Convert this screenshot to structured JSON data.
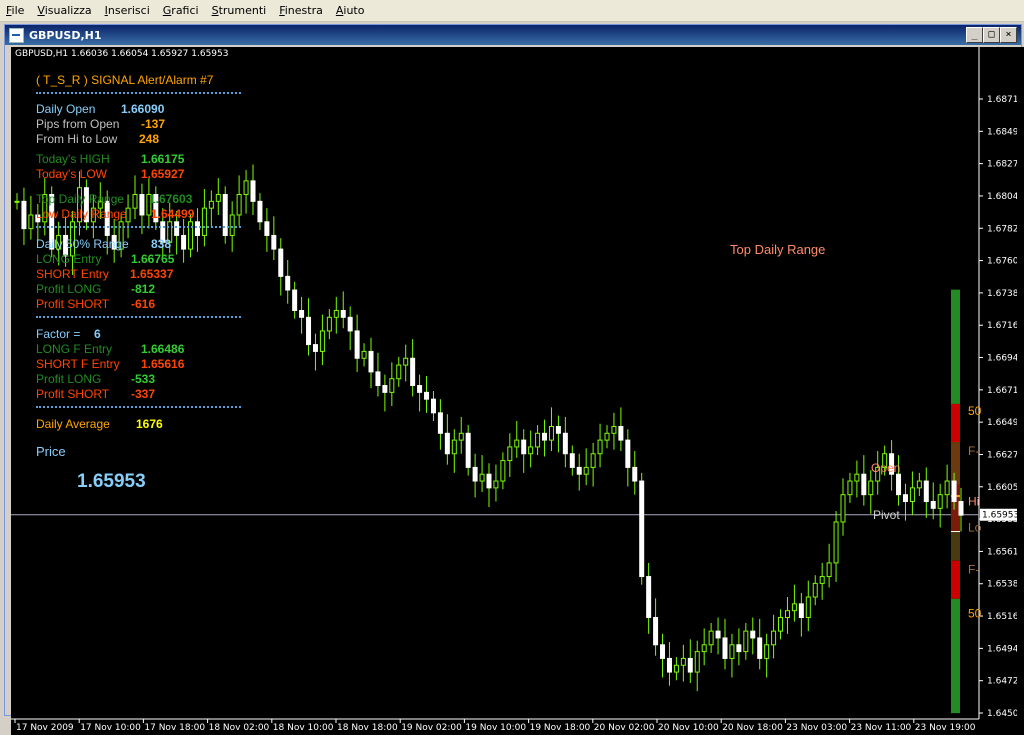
{
  "menu": [
    "File",
    "Visualizza",
    "Inserisci",
    "Grafici",
    "Strumenti",
    "Finestra",
    "Aiuto"
  ],
  "window": {
    "title": "GBPUSD,H1",
    "buttons": [
      "_",
      "□",
      "×"
    ]
  },
  "chart_header": "GBPUSD,H1  1.66036 1.66054 1.65927 1.65953",
  "indicator": {
    "title": "( T_S_R ) SIGNAL Alert/Alarm #7",
    "rows": [
      {
        "label": "Daily Open",
        "value": "1.66090",
        "label_color": "#87cefa",
        "value_color": "#87cefa"
      },
      {
        "label": "Pips from Open",
        "value": "-137",
        "label_color": "#c0c0c0",
        "value_color": "#ffa500"
      },
      {
        "label": "From Hi to Low",
        "value": "248",
        "label_color": "#c0c0c0",
        "value_color": "#ffa500"
      },
      {
        "label": "Today's HIGH",
        "value": "1.66175",
        "label_color": "#228b22",
        "value_color": "#32cd32"
      },
      {
        "label": "Today's LOW",
        "value": "1.65927",
        "label_color": "#ff4500",
        "value_color": "#ff4500"
      },
      {
        "label": "Top Daily Range",
        "value": "1.67603",
        "label_color": "#228b22",
        "value_color": "#228b22"
      },
      {
        "label": "Low Daily Range",
        "value": "1.64499",
        "label_color": "#ff4500",
        "value_color": "#ff4500"
      },
      {
        "label": "Daily 50% Range",
        "value": "838",
        "label_color": "#87cefa",
        "value_color": "#87cefa"
      },
      {
        "label": "LONG Entry",
        "value": "1.66765",
        "label_color": "#228b22",
        "value_color": "#32cd32"
      },
      {
        "label": "SHORT Entry",
        "value": "1.65337",
        "label_color": "#ff4500",
        "value_color": "#ff4500"
      },
      {
        "label": "Profit LONG",
        "value": "-812",
        "label_color": "#228b22",
        "value_color": "#32cd32"
      },
      {
        "label": "Profit SHORT",
        "value": "-616",
        "label_color": "#ff4500",
        "value_color": "#ff4500"
      },
      {
        "label": "Factor =",
        "value": "6",
        "label_color": "#87cefa",
        "value_color": "#87cefa"
      },
      {
        "label": "LONG F Entry",
        "value": "1.66486",
        "label_color": "#228b22",
        "value_color": "#32cd32"
      },
      {
        "label": "SHORT F Entry",
        "value": "1.65616",
        "label_color": "#ff4500",
        "value_color": "#ff4500"
      },
      {
        "label": "Profit LONG",
        "value": "-533",
        "label_color": "#228b22",
        "value_color": "#32cd32"
      },
      {
        "label": "Profit SHORT",
        "value": "-337",
        "label_color": "#ff4500",
        "value_color": "#ff4500"
      },
      {
        "label": "Daily Average",
        "value": "1676",
        "label_color": "#ffa500",
        "value_color": "#ffff00"
      }
    ],
    "price_label": "Price",
    "price_value": "1.65953"
  },
  "chart_labels": {
    "top_daily_range": "Top Daily Range",
    "open": "Open",
    "pivot": "Pivot",
    "right_labels": [
      "50",
      "F-",
      "Hi",
      "Lo",
      "F-",
      "50"
    ]
  },
  "chart_data": {
    "type": "candlestick",
    "symbol": "GBPUSD",
    "timeframe": "H1",
    "current_price": 1.65953,
    "ylim": [
      1.645,
      1.69
    ],
    "y_ticks": [
      "1.68710",
      "1.68490",
      "1.68270",
      "1.68045",
      "1.67825",
      "1.67605",
      "1.67380",
      "1.67160",
      "1.66940",
      "1.66715",
      "1.66495",
      "1.66275",
      "1.66050",
      "1.65830",
      "1.65610",
      "1.65385",
      "1.65165",
      "1.64940",
      "1.64720",
      "1.64500"
    ],
    "x_ticks": [
      "17 Nov 2009",
      "17 Nov 10:00",
      "17 Nov 18:00",
      "18 Nov 02:00",
      "18 Nov 10:00",
      "18 Nov 18:00",
      "19 Nov 02:00",
      "19 Nov 10:00",
      "19 Nov 18:00",
      "20 Nov 02:00",
      "20 Nov 10:00",
      "20 Nov 18:00",
      "23 Nov 03:00",
      "23 Nov 11:00",
      "23 Nov 19:00"
    ],
    "close_path": [
      1.6825,
      1.6805,
      1.6815,
      1.681,
      1.683,
      1.679,
      1.68,
      1.6785,
      1.681,
      1.6835,
      1.681,
      1.682,
      1.6825,
      1.68,
      1.679,
      1.681,
      1.682,
      1.683,
      1.6815,
      1.683,
      1.681,
      1.6795,
      1.681,
      1.68,
      1.679,
      1.681,
      1.68,
      1.682,
      1.6825,
      1.683,
      1.68,
      1.6815,
      1.683,
      1.684,
      1.6825,
      1.681,
      1.68,
      1.679,
      1.677,
      1.676,
      1.6745,
      1.674,
      1.672,
      1.6715,
      1.673,
      1.674,
      1.6745,
      1.674,
      1.673,
      1.671,
      1.6715,
      1.67,
      1.669,
      1.6685,
      1.6695,
      1.6705,
      1.671,
      1.669,
      1.6685,
      1.668,
      1.667,
      1.6655,
      1.664,
      1.665,
      1.6655,
      1.663,
      1.662,
      1.6625,
      1.6615,
      1.662,
      1.6635,
      1.6645,
      1.665,
      1.664,
      1.6645,
      1.6655,
      1.665,
      1.666,
      1.6655,
      1.664,
      1.663,
      1.6625,
      1.663,
      1.664,
      1.665,
      1.6655,
      1.666,
      1.665,
      1.663,
      1.662,
      1.655,
      1.652,
      1.65,
      1.649,
      1.648,
      1.6485,
      1.649,
      1.648,
      1.6495,
      1.65,
      1.651,
      1.6505,
      1.649,
      1.65,
      1.6495,
      1.651,
      1.6505,
      1.649,
      1.65,
      1.651,
      1.652,
      1.6525,
      1.653,
      1.652,
      1.6535,
      1.6545,
      1.655,
      1.656,
      1.659,
      1.661,
      1.662,
      1.6625,
      1.661,
      1.662,
      1.663,
      1.664,
      1.6625,
      1.661,
      1.6605,
      1.6615,
      1.662,
      1.6605,
      1.66,
      1.661,
      1.662,
      1.6605,
      1.6595
    ],
    "levels": [
      {
        "name": "Top Daily Range",
        "value": 1.67603,
        "color": "#228b22"
      },
      {
        "name": "LONG Entry",
        "value": 1.66765,
        "color": "#cc0000"
      },
      {
        "name": "LONG F Entry",
        "value": 1.66486,
        "color": "#6b3a0e"
      },
      {
        "name": "Today's HIGH",
        "value": 1.66175,
        "color": "#7a1c08"
      },
      {
        "name": "Pivot",
        "value": 1.6583,
        "color": "#4a3a10"
      },
      {
        "name": "SHORT F Entry",
        "value": 1.65616,
        "color": "#cc0000"
      },
      {
        "name": "SHORT Entry",
        "value": 1.65337,
        "color": "#228b22"
      },
      {
        "name": "Low Daily Range",
        "value": 1.64499,
        "color": "#228b22"
      }
    ]
  }
}
